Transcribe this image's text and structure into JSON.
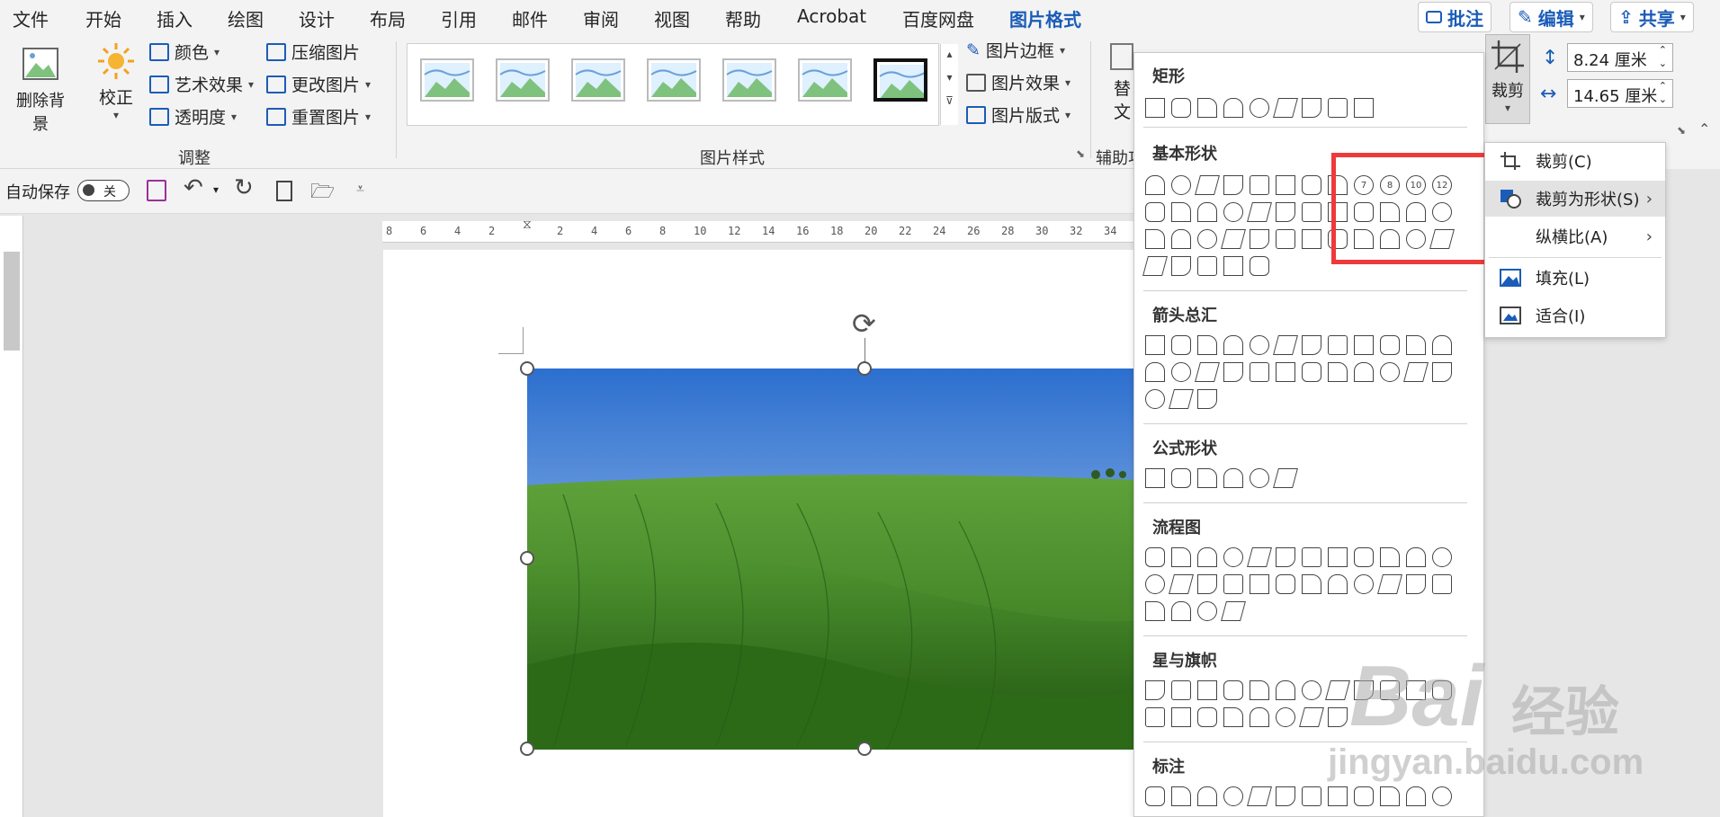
{
  "menu": {
    "tabs": [
      "文件",
      "开始",
      "插入",
      "绘图",
      "设计",
      "布局",
      "引用",
      "邮件",
      "审阅",
      "视图",
      "帮助",
      "Acrobat",
      "百度网盘",
      "图片格式"
    ],
    "active": "图片格式",
    "comment_btn": "批注",
    "edit_btn": "编辑",
    "share_btn": "共享"
  },
  "ribbon": {
    "remove_bg": "删除背景",
    "correct": "校正",
    "color": "颜色",
    "artistic": "艺术效果",
    "transparency": "透明度",
    "compress": "压缩图片",
    "change": "更改图片",
    "reset": "重置图片",
    "group_adjust": "调整",
    "group_styles": "图片样式",
    "border": "图片边框",
    "effects": "图片效果",
    "layout": "图片版式",
    "group_aux": "辅助功",
    "alt_text_1": "替",
    "alt_text_2": "文",
    "crop": "裁剪",
    "height": "8.24 厘米",
    "width": "14.65 厘米"
  },
  "qat": {
    "autosave": "自动保存",
    "toggle": "关"
  },
  "ruler_ticks": [
    "8",
    "6",
    "4",
    "2",
    "",
    "2",
    "4",
    "6",
    "8",
    "10",
    "12",
    "14",
    "16",
    "18",
    "20",
    "22",
    "24",
    "26",
    "28",
    "30",
    "32",
    "34"
  ],
  "gallery": {
    "rect": "矩形",
    "basic": "基本形状",
    "arrows": "箭头总汇",
    "equation": "公式形状",
    "flowchart": "流程图",
    "stars": "星与旗帜",
    "callouts": "标注",
    "num_7": "7",
    "num_8": "8",
    "num_10": "10",
    "num_12": "12"
  },
  "submenu": {
    "crop": "裁剪(C)",
    "crop_to_shape": "裁剪为形状(S)",
    "aspect": "纵横比(A)",
    "fill": "填充(L)",
    "fit": "适合(I)"
  },
  "watermark": {
    "brand": "Bai",
    "brand2": "经验",
    "url": "jingyan.baidu.com"
  },
  "colors": {
    "accent": "#1b5cb8",
    "highlight": "#ee3a3a"
  }
}
